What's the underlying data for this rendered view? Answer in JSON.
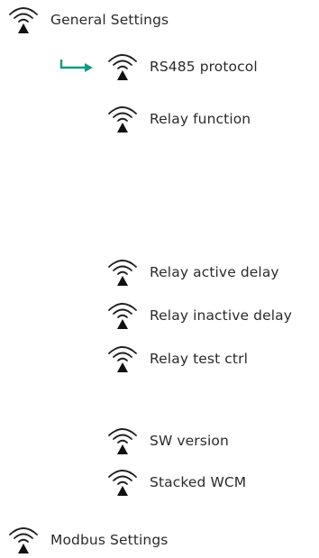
{
  "menu": {
    "top": {
      "label": "General Settings",
      "icon": "wireless-signal-icon"
    },
    "children": [
      {
        "label": "RS485 protocol",
        "icon": "wireless-signal-icon",
        "selected": true
      },
      {
        "label": "Relay function",
        "icon": "wireless-signal-icon"
      },
      {
        "label": "Relay active delay",
        "icon": "wireless-signal-icon"
      },
      {
        "label": "Relay inactive delay",
        "icon": "wireless-signal-icon"
      },
      {
        "label": "Relay test ctrl",
        "icon": "wireless-signal-icon"
      },
      {
        "label": "SW version",
        "icon": "wireless-signal-icon"
      },
      {
        "label": "Stacked WCM",
        "icon": "wireless-signal-icon"
      }
    ],
    "bottom": {
      "label": "Modbus Settings",
      "icon": "wireless-signal-icon"
    }
  },
  "colors": {
    "text": "#2b2b2b",
    "icon": "#1f1f1f",
    "selection_arrow": "#0f9b83"
  }
}
